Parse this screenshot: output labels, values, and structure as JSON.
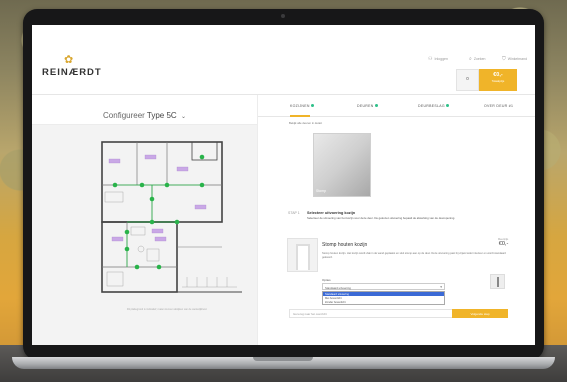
{
  "brand": {
    "logo_text": "REINÆRDT",
    "logo_mark": "✿",
    "accent": "#f0b429",
    "dot_color": "#2fc08a"
  },
  "header": {
    "utilities": [
      {
        "icon": "user-icon",
        "label": "Inloggen"
      },
      {
        "icon": "search-icon",
        "label": "Zoeken"
      },
      {
        "icon": "cart-icon",
        "label": "Winkelmand"
      }
    ],
    "cart_count": "0",
    "price": {
      "value": "€0,-",
      "label": "Totaalprijs"
    }
  },
  "configurator": {
    "title_prefix": "Configureer",
    "type_name": "Type 5C",
    "plan_caption": "Dit plattegrond is indicatief; maten kunnen afwijken van de werkelijkheid."
  },
  "tabs": [
    {
      "label": "KOZIJNEN",
      "done": true
    },
    {
      "label": "DEUREN",
      "done": true
    },
    {
      "label": "DEURBESLAG",
      "done": true
    },
    {
      "label": "OVER DEUR #1",
      "done": false
    }
  ],
  "intro": "Bekijk alle deuren in detail.",
  "swatch": {
    "label": "Stomp"
  },
  "step": {
    "number": "STAP 1",
    "title": "Selecteer uitvoering kozijn",
    "description": "Selecteer de uitvoering van het kozijn voor deze deur. De gekozen uitvoering bepaalt de afwerking van de deuropening."
  },
  "product": {
    "name": "Stomp houten kozijn",
    "price_label": "Meerprijs",
    "price": "€0,-",
    "description": "Stomp houten kozijn. Het kozijn wordt vlak in de wand geplaatst en sluit stomp aan op de deur. Deze uitvoering past bij vrijwel ieder interieur en wordt standaard geleverd.",
    "options_label": "Opties",
    "selected_option": "Standaard uitvoering",
    "dropdown": [
      "Standaard uitvoering",
      "Met bovenlicht",
      "Zonder bovenlicht"
    ]
  },
  "footer": {
    "bar_label": "Ga terug naar het overzicht",
    "cta": "Volgende stap"
  }
}
